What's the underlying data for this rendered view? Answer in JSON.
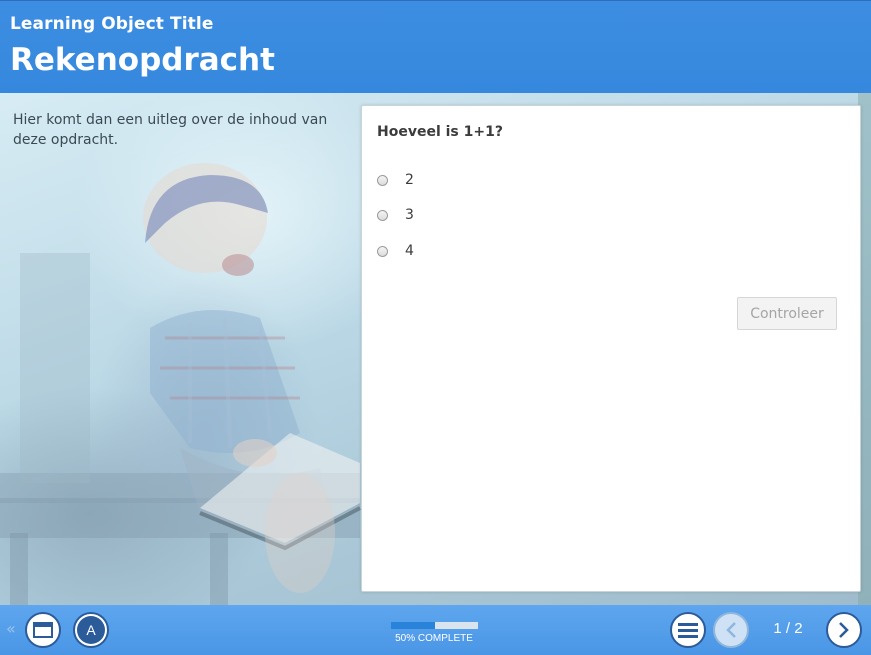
{
  "header": {
    "lo_title": "Learning Object Title",
    "page_title": "Rekenopdracht"
  },
  "intro": {
    "text": "Hier komt dan een uitleg over de inhoud van deze opdracht."
  },
  "question": {
    "text": "Hoeveel is 1+1?",
    "options": [
      {
        "label": "2",
        "selected": false
      },
      {
        "label": "3",
        "selected": false
      },
      {
        "label": "4",
        "selected": false
      }
    ],
    "check_label": "Controleer"
  },
  "footer": {
    "progress_fraction": 0.5,
    "progress_text": "50% COMPLETE",
    "page_counter": "1 / 2",
    "avatar_letter": "A",
    "icons": [
      "double-chevron-left-icon",
      "window-icon",
      "menu-icon",
      "chevron-left-icon",
      "chevron-right-icon"
    ]
  },
  "colors": {
    "header_blue": "#3588dd",
    "footer_blue": "#4a96e6",
    "progress_fill": "#2a83db",
    "button_outline": "#2c5b9a"
  }
}
